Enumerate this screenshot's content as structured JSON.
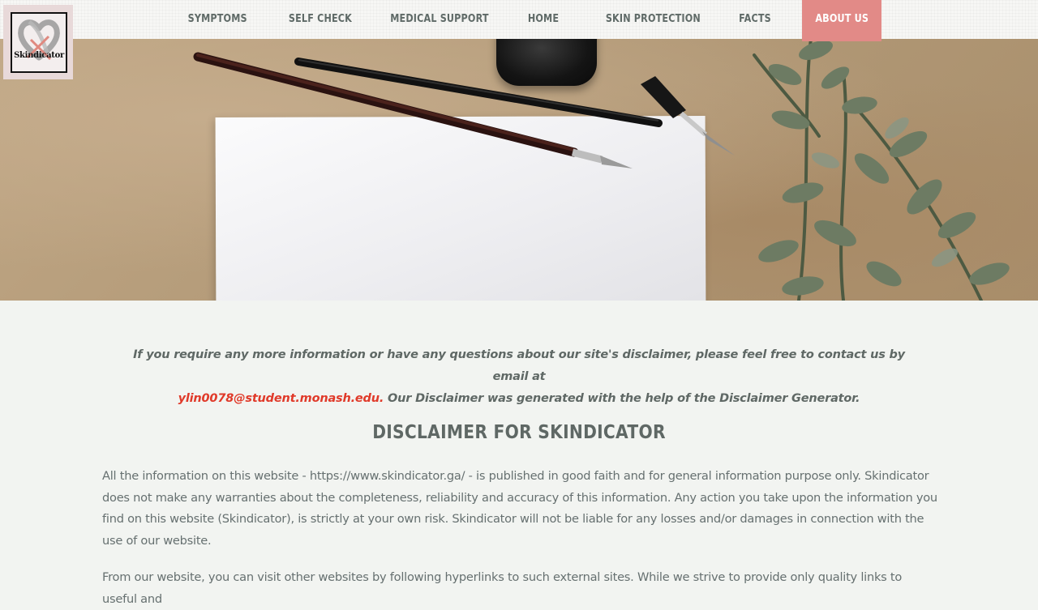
{
  "logo": {
    "text": "Skindicator"
  },
  "nav": {
    "items": [
      {
        "label": "SYMPTOMS"
      },
      {
        "label": "SELF CHECK"
      },
      {
        "label": "MEDICAL SUPPORT"
      },
      {
        "label": "HOME"
      },
      {
        "label": "SKIN PROTECTION"
      },
      {
        "label": "FACTS"
      },
      {
        "label": "ABOUT US"
      }
    ],
    "active_index": 6,
    "active_color": "#e28a87"
  },
  "content": {
    "intro_before": "If you require any more information or have any questions about our site's disclaimer, please feel free to contact us by email at",
    "email": "ylin0078@student.monash.edu.",
    "intro_after": "Our Disclaimer was generated with the help of the Disclaimer Generator.",
    "heading": "DISCLAIMER FOR SKINDICATOR",
    "paragraph1": "All the information on this website - https://www.skindicator.ga/ - is published in good faith and for general information purpose only. Skindicator does not make any warranties about the completeness, reliability and accuracy of this information. Any action you take upon the information you find on this website (Skindicator), is strictly at your own risk. Skindicator will not be liable for any losses and/or damages in connection with the use of our website.",
    "paragraph2": "From our website, you can visit other websites by following hyperlinks to such external sites. While we strive to provide only quality links to useful and"
  },
  "colors": {
    "link": "#e03a2a",
    "text": "#5f6865",
    "background": "#f2f4f1"
  }
}
